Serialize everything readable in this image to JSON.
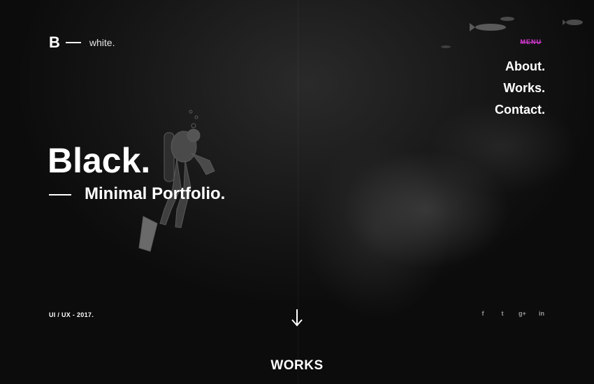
{
  "logo": {
    "mark": "B",
    "text": "white."
  },
  "menu": {
    "label": "MENU"
  },
  "nav": {
    "items": [
      {
        "label": "About."
      },
      {
        "label": "Works."
      },
      {
        "label": "Contact."
      }
    ]
  },
  "hero": {
    "title": "Black.",
    "subtitle": "Minimal Portfolio."
  },
  "footer": {
    "year_text": "UI / UX  - 2017.",
    "socials": [
      {
        "icon": "facebook-icon",
        "glyph": "f"
      },
      {
        "icon": "twitter-icon",
        "glyph": "t"
      },
      {
        "icon": "google-plus-icon",
        "glyph": "g+"
      },
      {
        "icon": "linkedin-icon",
        "glyph": "in"
      }
    ]
  },
  "section": {
    "works_label": "WORKS"
  },
  "colors": {
    "accent": "#d93ad6",
    "background": "#121212",
    "text": "#ffffff"
  }
}
